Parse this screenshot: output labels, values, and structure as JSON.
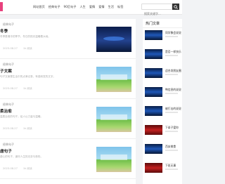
{
  "header": {
    "nav": [
      "网站首页",
      "经典句子",
      "90后句子",
      "人生",
      "爱情",
      "爱情",
      "生活",
      "标签"
    ],
    "search_placeholder": "搜索关键字..."
  },
  "posts": [
    {
      "category": "经典句子",
      "title": "冬季",
      "excerpt": "冬季是清冷的季节，冬日的阳光温暖着大地。",
      "date": "2023-08-27",
      "views": "1k 阅读",
      "thumb_style": "night"
    },
    {
      "category": "经典句子",
      "title": "子文案",
      "excerpt": "句子文案是生活中的点滴记录，有感而发的文字。",
      "date": "2023-08-27",
      "views": "1k 阅读",
      "thumb_style": "green"
    },
    {
      "category": "经典句子",
      "title": "柔治愈",
      "excerpt": "温柔治愈的句子，给人以力量与温暖。",
      "date": "2023-08-27",
      "views": "1k 阅读",
      "thumb_style": "green"
    },
    {
      "category": "经典句子",
      "title": "虐句子",
      "excerpt": "虐心的句子，道尽人生的无奈与悲伤。",
      "date": "2023-08-27",
      "views": "1k 阅读",
      "thumb_style": "green"
    }
  ],
  "sidebar": {
    "heading": "热门文章",
    "items": [
      {
        "title": "同学聚会说说",
        "style": "dark"
      },
      {
        "title": "是否一样快乐",
        "style": "dark"
      },
      {
        "title": "适合发朋友圈",
        "style": "dark"
      },
      {
        "title": "鸭信息的说说",
        "style": "dark"
      },
      {
        "title": "被打击的说说",
        "style": "dark"
      },
      {
        "title": "下辈子爱你",
        "style": "red"
      },
      {
        "title": "西安美食",
        "style": "dark"
      },
      {
        "title": "下班无事",
        "style": "red"
      }
    ]
  },
  "colors": {
    "brand": "#e8417d",
    "search_button": "#333333"
  }
}
